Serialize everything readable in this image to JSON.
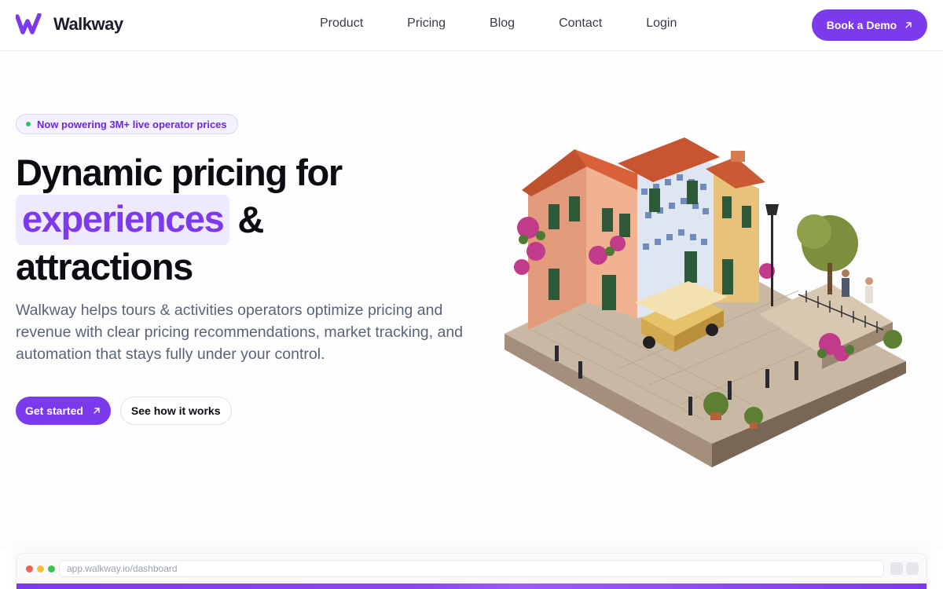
{
  "header": {
    "logo_text": "Walkway",
    "nav": [
      {
        "label": "Product"
      },
      {
        "label": "Pricing"
      },
      {
        "label": "Blog"
      },
      {
        "label": "Contact"
      },
      {
        "label": "Login"
      }
    ],
    "demo_button": "Book a Demo"
  },
  "hero": {
    "badge": "Now powering 3M+ live operator prices",
    "headline_line1": "Dynamic pricing for",
    "headline_highlight": "experiences",
    "headline_amp": "&",
    "headline_line3": "attractions",
    "subtext": "Walkway helps tours & activities operators optimize pricing and revenue with clear pricing recommendations, market tracking, and automation that stays fully under your control.",
    "cta_primary": "Get started",
    "cta_secondary": "See how it works"
  },
  "browser": {
    "url": "app.walkway.io/dashboard"
  },
  "colors": {
    "accent": "#7c3aed",
    "highlight_bg": "#efe9fd",
    "status_dot": "#22c55e"
  }
}
